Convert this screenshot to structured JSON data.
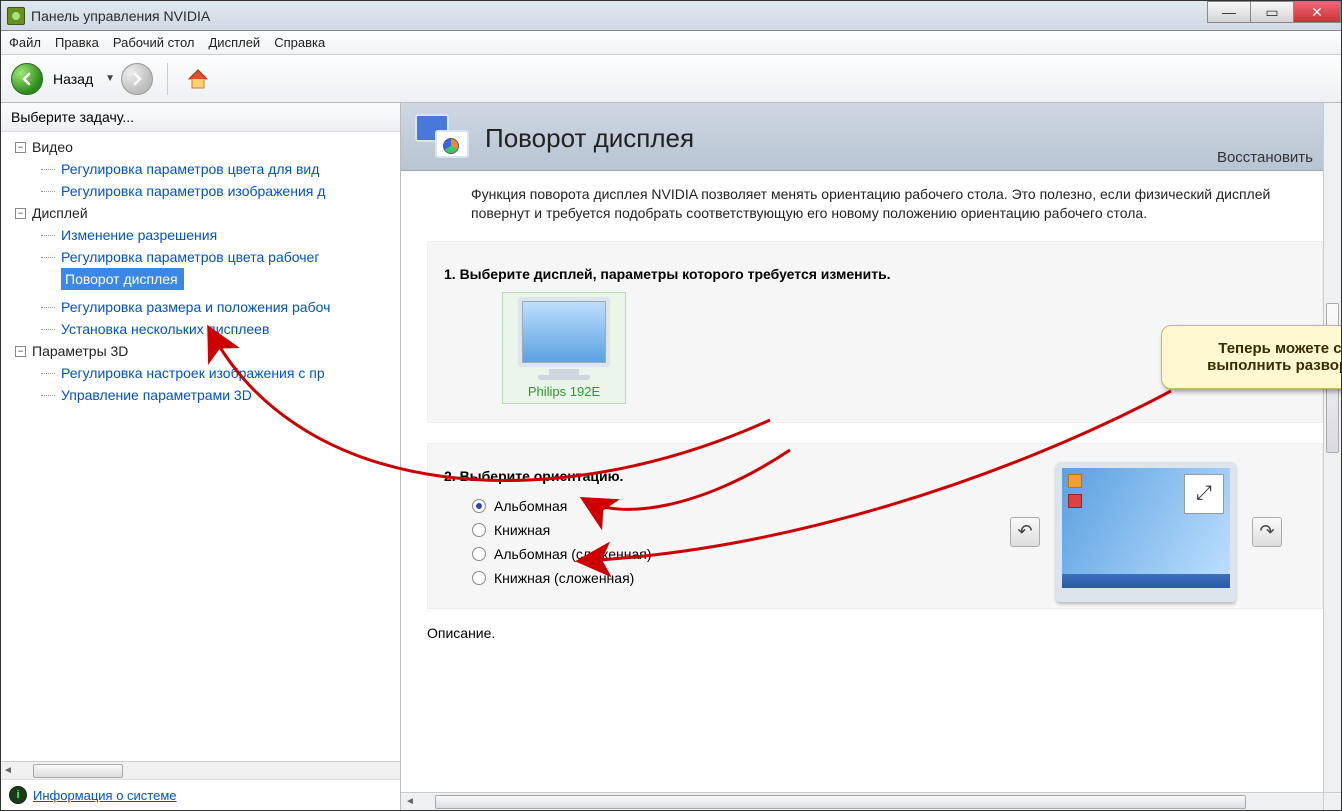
{
  "window": {
    "title": "Панель управления NVIDIA"
  },
  "menubar": [
    "Файл",
    "Правка",
    "Рабочий стол",
    "Дисплей",
    "Справка"
  ],
  "toolbar": {
    "back_label": "Назад"
  },
  "leftpanel": {
    "header": "Выберите задачу...",
    "tree": {
      "video": {
        "label": "Видео",
        "items": [
          "Регулировка параметров цвета для вид",
          "Регулировка параметров изображения д"
        ]
      },
      "display": {
        "label": "Дисплей",
        "items": [
          "Изменение разрешения",
          "Регулировка параметров цвета рабочег",
          "Поворот дисплея",
          "Регулировка размера и положения рабоч",
          "Установка нескольких дисплеев"
        ]
      },
      "params3d": {
        "label": "Параметры 3D",
        "items": [
          "Регулировка настроек изображения с пр",
          "Управление параметрами 3D"
        ]
      }
    },
    "footer_link": "Информация о системе"
  },
  "rightpanel": {
    "title": "Поворот дисплея",
    "restore": "Восстановить",
    "description": "Функция поворота дисплея NVIDIA позволяет менять ориентацию рабочего стола. Это полезно, если физический дисплей повернут и требуется подобрать соответствующую его новому положению ориентацию рабочего стола.",
    "step1_title": "1. Выберите дисплей, параметры которого требуется изменить.",
    "monitor_name": "Philips 192E",
    "step2_title": "2. Выберите ориентацию.",
    "orientations": [
      "Альбомная",
      "Книжная",
      "Альбомная (сложенная)",
      "Книжная (сложенная)"
    ],
    "desc_label": "Описание."
  },
  "annotation": {
    "callout": "Теперь можете с легкостью выполнить разворот десплея!"
  }
}
